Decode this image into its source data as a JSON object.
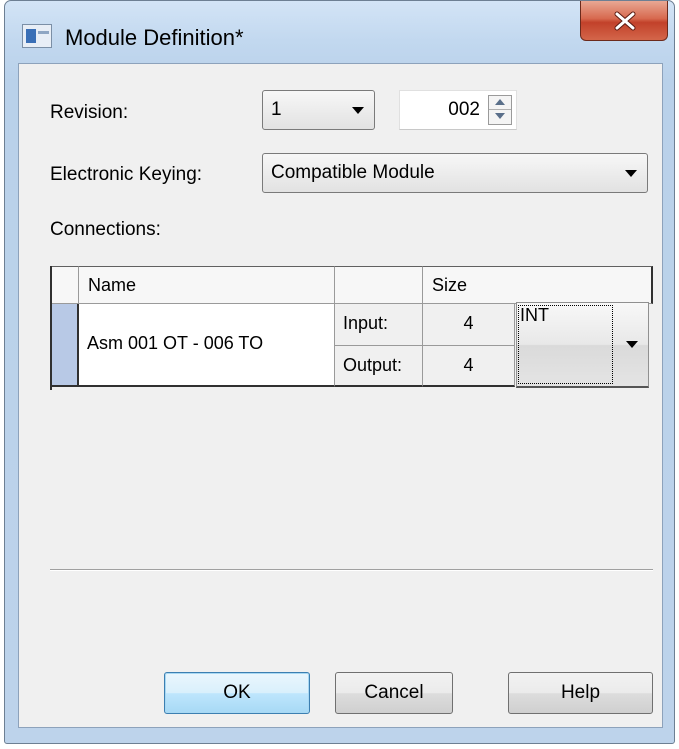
{
  "window": {
    "title": "Module Definition*"
  },
  "form": {
    "revision_label": "Revision:",
    "revision_major": "1",
    "revision_minor": "002",
    "keying_label": "Electronic Keying:",
    "keying_value": "Compatible Module",
    "connections_label": "Connections:"
  },
  "connections_table": {
    "headers": [
      "Name",
      "",
      "Size"
    ],
    "rows": [
      {
        "name": "Asm 001 OT - 006 TO",
        "input_label": "Input:",
        "input_size": "4",
        "output_label": "Output:",
        "output_size": "4",
        "data_type": "INT"
      }
    ]
  },
  "buttons": {
    "ok": "OK",
    "cancel": "Cancel",
    "help": "Help"
  }
}
